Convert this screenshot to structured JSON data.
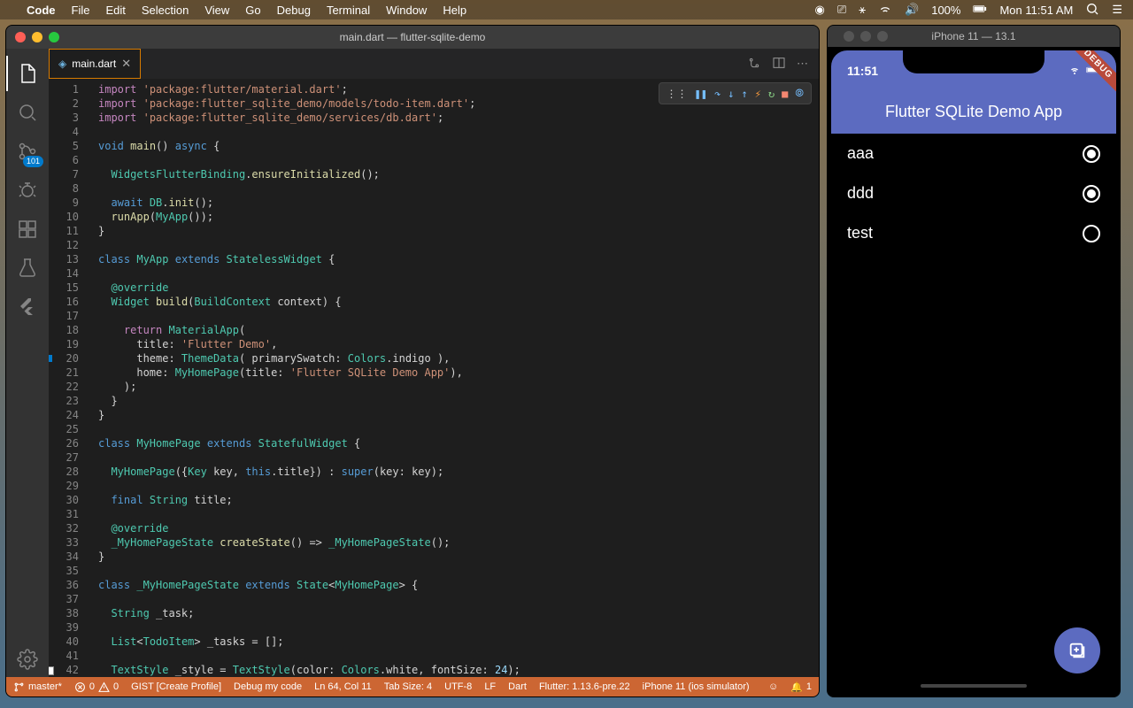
{
  "mac_menu": {
    "app": "Code",
    "items": [
      "File",
      "Edit",
      "Selection",
      "View",
      "Go",
      "Debug",
      "Terminal",
      "Window",
      "Help"
    ],
    "battery": "100%",
    "clock": "Mon 11:51 AM"
  },
  "window_title": "main.dart — flutter-sqlite-demo",
  "tab": {
    "name": "main.dart",
    "dirty": true
  },
  "scm_badge": "101",
  "code_lines": [
    [
      [
        "k",
        "import"
      ],
      [
        "op",
        " "
      ],
      [
        "str",
        "'package:flutter/material.dart'"
      ],
      [
        "op",
        ";"
      ]
    ],
    [
      [
        "k",
        "import"
      ],
      [
        "op",
        " "
      ],
      [
        "str",
        "'package:flutter_sqlite_demo/models/todo-item.dart'"
      ],
      [
        "op",
        ";"
      ]
    ],
    [
      [
        "k",
        "import"
      ],
      [
        "op",
        " "
      ],
      [
        "str",
        "'package:flutter_sqlite_demo/services/db.dart'"
      ],
      [
        "op",
        ";"
      ]
    ],
    [],
    [
      [
        "kb",
        "void"
      ],
      [
        "op",
        " "
      ],
      [
        "fn",
        "main"
      ],
      [
        "op",
        "() "
      ],
      [
        "kb",
        "async"
      ],
      [
        "op",
        " {"
      ]
    ],
    [],
    [
      [
        "op",
        "  "
      ],
      [
        "cl",
        "WidgetsFlutterBinding"
      ],
      [
        "op",
        "."
      ],
      [
        "fn",
        "ensureInitialized"
      ],
      [
        "op",
        "();"
      ]
    ],
    [],
    [
      [
        "op",
        "  "
      ],
      [
        "kb",
        "await"
      ],
      [
        "op",
        " "
      ],
      [
        "cl",
        "DB"
      ],
      [
        "op",
        "."
      ],
      [
        "fn",
        "init"
      ],
      [
        "op",
        "();"
      ]
    ],
    [
      [
        "op",
        "  "
      ],
      [
        "fn",
        "runApp"
      ],
      [
        "op",
        "("
      ],
      [
        "cl",
        "MyApp"
      ],
      [
        "op",
        "());"
      ]
    ],
    [
      [
        "op",
        "}"
      ]
    ],
    [],
    [
      [
        "kb",
        "class"
      ],
      [
        "op",
        " "
      ],
      [
        "cl",
        "MyApp"
      ],
      [
        "op",
        " "
      ],
      [
        "kb",
        "extends"
      ],
      [
        "op",
        " "
      ],
      [
        "cl",
        "StatelessWidget"
      ],
      [
        "op",
        " {"
      ]
    ],
    [],
    [
      [
        "op",
        "  "
      ],
      [
        "an",
        "@override"
      ]
    ],
    [
      [
        "op",
        "  "
      ],
      [
        "cl",
        "Widget"
      ],
      [
        "op",
        " "
      ],
      [
        "fn",
        "build"
      ],
      [
        "op",
        "("
      ],
      [
        "cl",
        "BuildContext"
      ],
      [
        "op",
        " context) {"
      ]
    ],
    [],
    [
      [
        "op",
        "    "
      ],
      [
        "k",
        "return"
      ],
      [
        "op",
        " "
      ],
      [
        "cl",
        "MaterialApp"
      ],
      [
        "op",
        "("
      ]
    ],
    [
      [
        "op",
        "      title: "
      ],
      [
        "str",
        "'Flutter Demo'"
      ],
      [
        "op",
        ","
      ]
    ],
    [
      [
        "op",
        "      theme: "
      ],
      [
        "cl",
        "ThemeData"
      ],
      [
        "op",
        "( primarySwatch: "
      ],
      [
        "cl",
        "Colors"
      ],
      [
        "op",
        ".indigo ),"
      ]
    ],
    [
      [
        "op",
        "      home: "
      ],
      [
        "cl",
        "MyHomePage"
      ],
      [
        "op",
        "(title: "
      ],
      [
        "str",
        "'Flutter SQLite Demo App'"
      ],
      [
        "op",
        "),"
      ]
    ],
    [
      [
        "op",
        "    );"
      ]
    ],
    [
      [
        "op",
        "  }"
      ]
    ],
    [
      [
        "op",
        "}"
      ]
    ],
    [],
    [
      [
        "kb",
        "class"
      ],
      [
        "op",
        " "
      ],
      [
        "cl",
        "MyHomePage"
      ],
      [
        "op",
        " "
      ],
      [
        "kb",
        "extends"
      ],
      [
        "op",
        " "
      ],
      [
        "cl",
        "StatefulWidget"
      ],
      [
        "op",
        " {"
      ]
    ],
    [],
    [
      [
        "op",
        "  "
      ],
      [
        "cl",
        "MyHomePage"
      ],
      [
        "op",
        "({"
      ],
      [
        "cl",
        "Key"
      ],
      [
        "op",
        " key, "
      ],
      [
        "kb",
        "this"
      ],
      [
        "op",
        ".title}) : "
      ],
      [
        "kb",
        "super"
      ],
      [
        "op",
        "(key: key);"
      ]
    ],
    [],
    [
      [
        "op",
        "  "
      ],
      [
        "kb",
        "final"
      ],
      [
        "op",
        " "
      ],
      [
        "cl",
        "String"
      ],
      [
        "op",
        " title;"
      ]
    ],
    [],
    [
      [
        "op",
        "  "
      ],
      [
        "an",
        "@override"
      ]
    ],
    [
      [
        "op",
        "  "
      ],
      [
        "cl",
        "_MyHomePageState"
      ],
      [
        "op",
        " "
      ],
      [
        "fn",
        "createState"
      ],
      [
        "op",
        "() => "
      ],
      [
        "cl",
        "_MyHomePageState"
      ],
      [
        "op",
        "();"
      ]
    ],
    [
      [
        "op",
        "}"
      ]
    ],
    [],
    [
      [
        "kb",
        "class"
      ],
      [
        "op",
        " "
      ],
      [
        "cl",
        "_MyHomePageState"
      ],
      [
        "op",
        " "
      ],
      [
        "kb",
        "extends"
      ],
      [
        "op",
        " "
      ],
      [
        "cl",
        "State"
      ],
      [
        "op",
        "<"
      ],
      [
        "cl",
        "MyHomePage"
      ],
      [
        "op",
        "> {"
      ]
    ],
    [],
    [
      [
        "op",
        "  "
      ],
      [
        "cl",
        "String"
      ],
      [
        "op",
        " _task;"
      ]
    ],
    [],
    [
      [
        "op",
        "  "
      ],
      [
        "cl",
        "List"
      ],
      [
        "op",
        "<"
      ],
      [
        "cl",
        "TodoItem"
      ],
      [
        "op",
        "> _tasks = [];"
      ]
    ],
    [],
    [
      [
        "op",
        "  "
      ],
      [
        "cl",
        "TextStyle"
      ],
      [
        "op",
        " _style = "
      ],
      [
        "cl",
        "TextStyle"
      ],
      [
        "op",
        "(color: "
      ],
      [
        "cl",
        "Colors"
      ],
      [
        "op",
        ".white, fontSize: "
      ],
      [
        "va",
        "24"
      ],
      [
        "op",
        ");"
      ]
    ]
  ],
  "decorations": {
    "blue": 20,
    "stop": 42
  },
  "status_bar": {
    "branch": "master*",
    "errors": "0",
    "warnings": "0",
    "gist": "GIST [Create Profile]",
    "debug": "Debug my code",
    "pos": "Ln 64, Col 11",
    "tab": "Tab Size: 4",
    "enc": "UTF-8",
    "eol": "LF",
    "lang": "Dart",
    "flutter": "Flutter: 1.13.6-pre.22",
    "device": "iPhone 11 (ios simulator)",
    "bell": "1"
  },
  "simulator": {
    "title": "iPhone 11 — 13.1",
    "time": "11:51",
    "app_title": "Flutter SQLite Demo App",
    "debug_banner": "DEBUG",
    "items": [
      {
        "label": "aaa",
        "checked": true
      },
      {
        "label": "ddd",
        "checked": true
      },
      {
        "label": "test",
        "checked": false
      }
    ]
  }
}
